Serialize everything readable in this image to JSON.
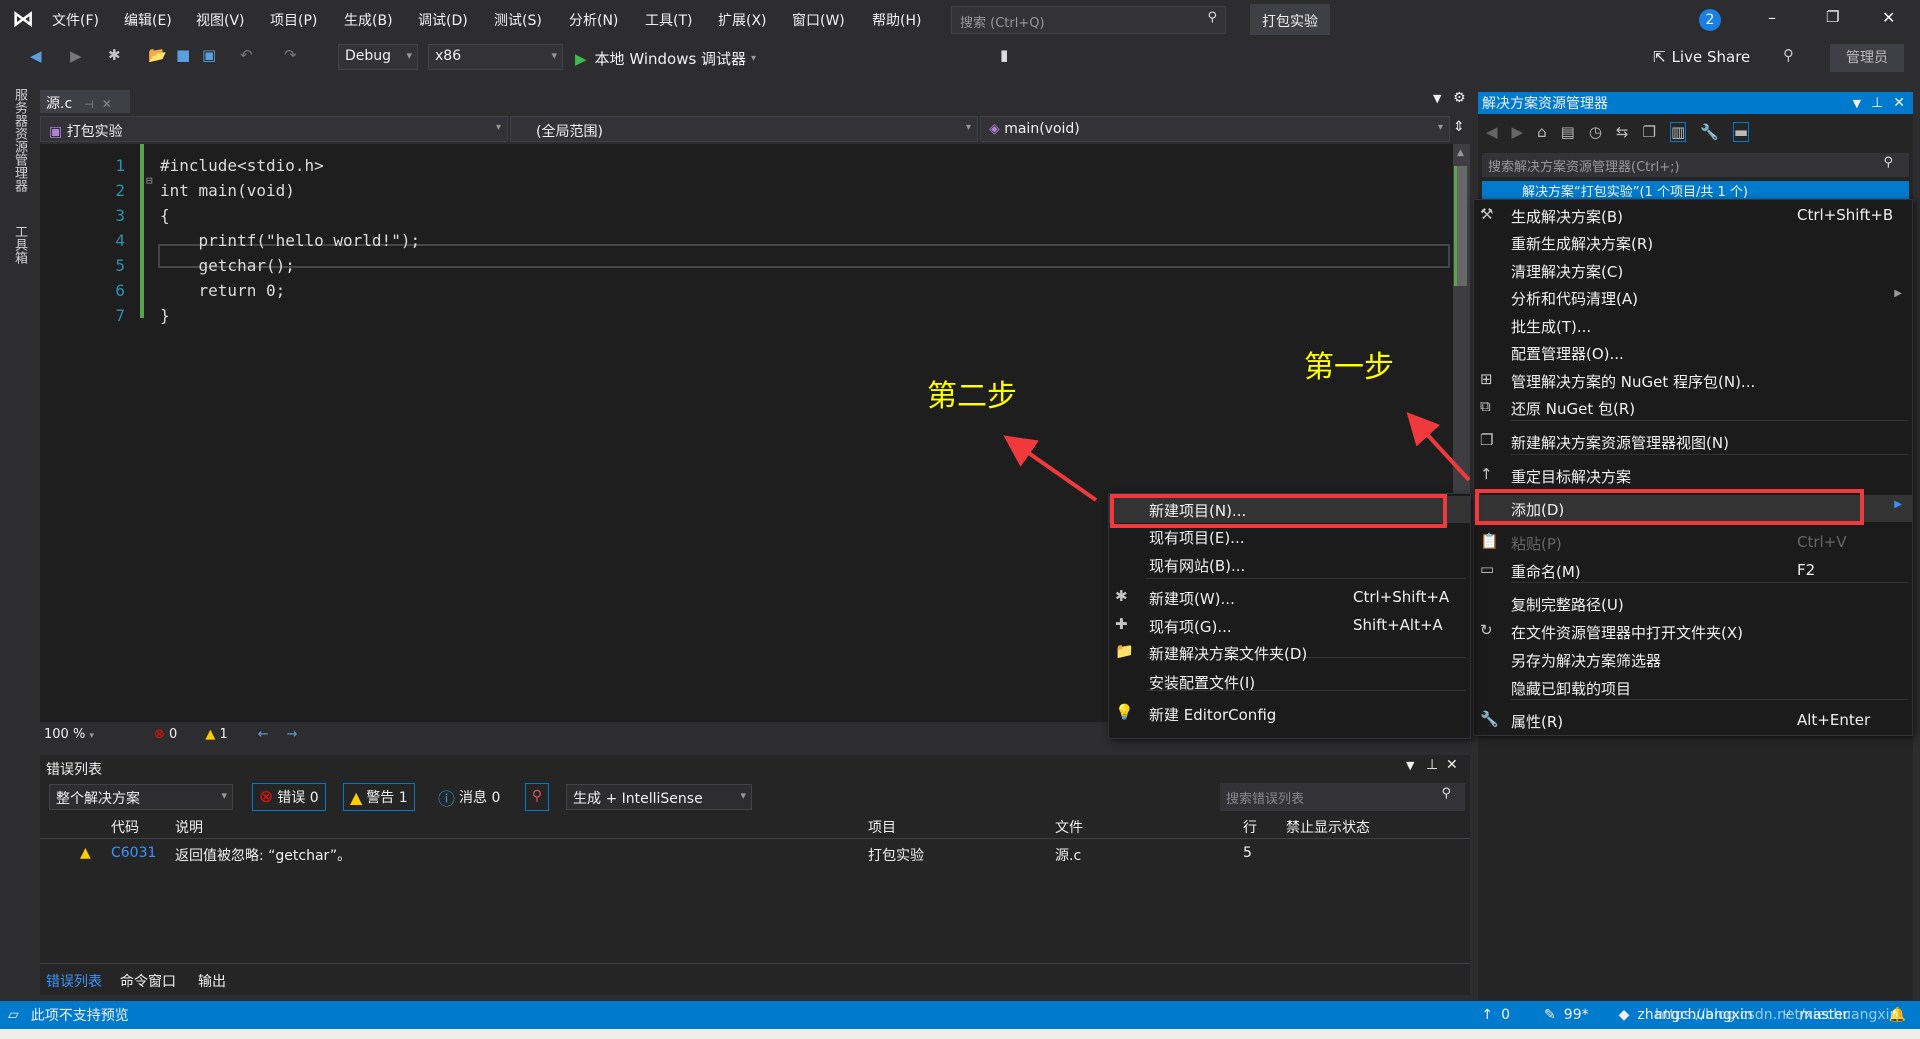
{
  "titlebar": {
    "menus": [
      "文件(F)",
      "编辑(E)",
      "视图(V)",
      "项目(P)",
      "生成(B)",
      "调试(D)",
      "测试(S)",
      "分析(N)",
      "工具(T)",
      "扩展(X)",
      "窗口(W)",
      "帮助(H)"
    ],
    "search_placeholder": "搜索 (Ctrl+Q)",
    "project": "打包实验",
    "notifications": "2"
  },
  "toolbar": {
    "config": "Debug",
    "platform": "x86",
    "run": "本地 Windows 调试器",
    "live_share": "Live Share",
    "admin": "管理员"
  },
  "left_strip": [
    "服务器资源管理器",
    "工具箱"
  ],
  "editor": {
    "tab": "源.c",
    "nav_project": "打包实验",
    "nav_scope": "(全局范围)",
    "nav_member": "main(void)",
    "lines": [
      {
        "n": "1",
        "t": "#include<stdio.h>"
      },
      {
        "n": "2",
        "t": "int main(void)"
      },
      {
        "n": "3",
        "t": "{"
      },
      {
        "n": "4",
        "t": "    printf(\"hello world!\");"
      },
      {
        "n": "5",
        "t": "    getchar();"
      },
      {
        "n": "6",
        "t": "    return 0;"
      },
      {
        "n": "7",
        "t": "}"
      }
    ],
    "zoom": "100 %",
    "errors": "0",
    "warnings": "1"
  },
  "error_list": {
    "title": "错误列表",
    "scope": "整个解决方案",
    "errors_btn": "错误 0",
    "warnings_btn": "警告 1",
    "messages_btn": "消息 0",
    "source": "生成 + IntelliSense",
    "search_placeholder": "搜索错误列表",
    "columns": [
      "代码",
      "说明",
      "项目",
      "文件",
      "行",
      "禁止显示状态"
    ],
    "rows": [
      {
        "code": "C6031",
        "desc": "返回值被忽略: “getchar”。",
        "project": "打包实验",
        "file": "源.c",
        "line": "5"
      }
    ],
    "tabs": [
      "错误列表",
      "命令窗口",
      "输出"
    ]
  },
  "solution_explorer": {
    "title": "解决方案资源管理器",
    "search_placeholder": "搜索解决方案资源管理器(Ctrl+;)",
    "selected": "解决方案“打包实验”(1 个项目/共 1 个)"
  },
  "context_menu": [
    {
      "label": "生成解决方案(B)",
      "shortcut": "Ctrl+Shift+B",
      "icon": "build-icon"
    },
    {
      "label": "重新生成解决方案(R)"
    },
    {
      "label": "清理解决方案(C)"
    },
    {
      "label": "分析和代码清理(A)",
      "submenu": true
    },
    {
      "label": "批生成(T)..."
    },
    {
      "label": "配置管理器(O)..."
    },
    {
      "label": "管理解决方案的 NuGet 程序包(N)...",
      "icon": "nuget-icon"
    },
    {
      "label": "还原 NuGet 包(R)",
      "icon": "restore-icon"
    },
    {
      "label": "新建解决方案资源管理器视图(N)",
      "icon": "new-view-icon"
    },
    {
      "label": "重定目标解决方案",
      "icon": "arrow-up-icon"
    },
    {
      "label": "添加(D)",
      "submenu": true
    },
    {
      "label": "粘贴(P)",
      "shortcut": "Ctrl+V",
      "disabled": true,
      "icon": "paste-icon"
    },
    {
      "label": "重命名(M)",
      "shortcut": "F2",
      "icon": "rename-icon"
    },
    {
      "label": "复制完整路径(U)"
    },
    {
      "label": "在文件资源管理器中打开文件夹(X)",
      "icon": "open-folder-icon"
    },
    {
      "label": "另存为解决方案筛选器"
    },
    {
      "label": "隐藏已卸载的项目"
    },
    {
      "label": "属性(R)",
      "shortcut": "Alt+Enter",
      "icon": "wrench-icon"
    }
  ],
  "add_submenu": [
    {
      "label": "新建项目(N)..."
    },
    {
      "label": "现有项目(E)..."
    },
    {
      "label": "现有网站(B)..."
    },
    {
      "label": "新建项(W)...",
      "shortcut": "Ctrl+Shift+A"
    },
    {
      "label": "现有项(G)...",
      "shortcut": "Shift+Alt+A"
    },
    {
      "label": "新建解决方案文件夹(D)"
    },
    {
      "label": "安装配置文件(I)"
    },
    {
      "label": "新建 EditorConfig"
    }
  ],
  "annotations": {
    "step1": "第一步",
    "step2": "第二步",
    "color": "#ffff00",
    "highlight_color": "#f0393c"
  },
  "statusbar": {
    "message": "此项不支持预览",
    "up": "0",
    "edits": "99*",
    "user": "zhangchuangxin",
    "branch": "master",
    "watermark": "https://blog.csdn.net/xiechuangxin"
  },
  "colors": {
    "accent": "#007acc",
    "bg": "#2d2d30",
    "editor": "#1e1e1e"
  }
}
